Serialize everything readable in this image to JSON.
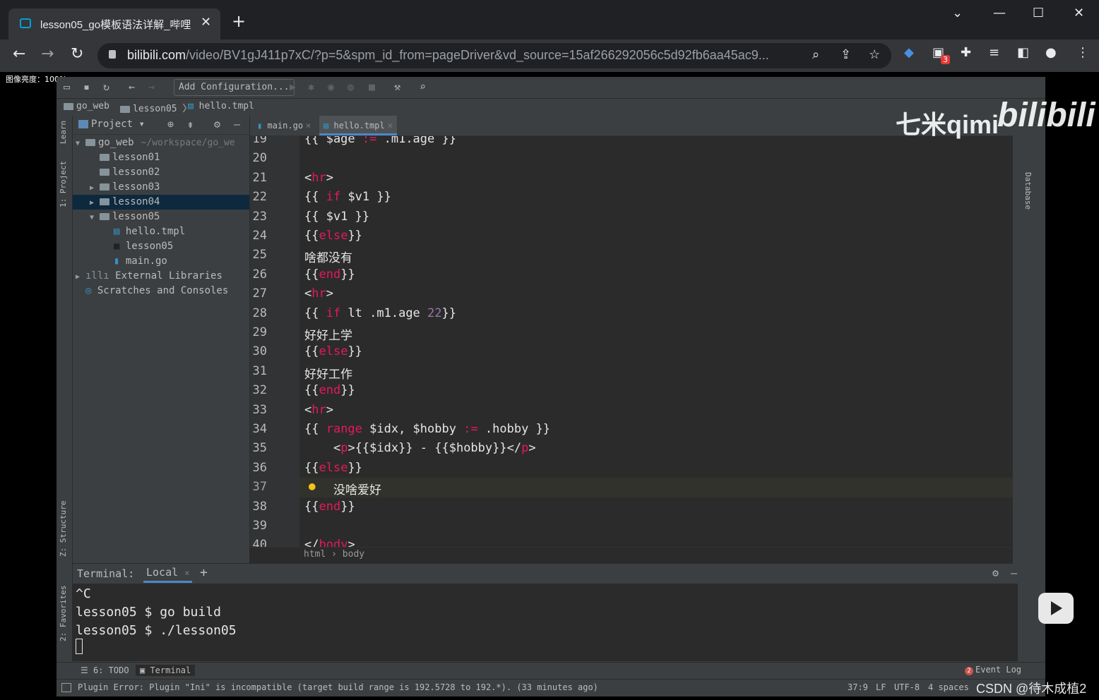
{
  "browser": {
    "tab_title": "lesson05_go模板语法详解_哔哩",
    "tab_close": "✕",
    "new_tab": "+",
    "url_host": "bilibili.com",
    "url_path": "/video/BV1gJ411p7xC/?p=5&spm_id_from=pageDriver&vd_source=15af266292056c5d92fb6aa45ac9...",
    "extension_badge": "3",
    "icons": [
      "back-icon",
      "forward-icon",
      "reload-icon",
      "lock-icon",
      "zoom-icon",
      "share-icon",
      "star-icon",
      "extensions-icon",
      "reading-list-icon",
      "sidepanel-icon",
      "profile-icon",
      "menu-icon"
    ]
  },
  "overlay": {
    "brightness": "图像亮度：100%",
    "watermark_qimi": "七米qimi",
    "watermark_bili": "bilibili",
    "csdn": "CSDN @待木成植2"
  },
  "ide": {
    "add_configuration": "Add Configuration...",
    "breadcrumb": [
      "go_web",
      "lesson05",
      "hello.tmpl"
    ],
    "left_strip": [
      "Learn",
      "1: Project",
      "Z: Structure",
      "2: Favorites"
    ],
    "right_strip": "Database",
    "project": {
      "title": "Project",
      "tree": [
        {
          "label": "go_web",
          "path": "~/workspace/go_we",
          "arrow": "▼",
          "indent": 0
        },
        {
          "label": "lesson01",
          "arrow": "",
          "indent": 1
        },
        {
          "label": "lesson02",
          "arrow": "",
          "indent": 1
        },
        {
          "label": "lesson03",
          "arrow": "▶",
          "indent": 1
        },
        {
          "label": "lesson04",
          "arrow": "▶",
          "indent": 1,
          "selected": true
        },
        {
          "label": "lesson05",
          "arrow": "▼",
          "indent": 1
        },
        {
          "label": "hello.tmpl",
          "arrow": "",
          "indent": 2
        },
        {
          "label": "lesson05",
          "arrow": "",
          "indent": 2
        },
        {
          "label": "main.go",
          "arrow": "",
          "indent": 2
        },
        {
          "label": "External Libraries",
          "arrow": "▶",
          "indent": 0
        },
        {
          "label": "Scratches and Consoles",
          "arrow": "",
          "indent": 0
        }
      ]
    },
    "tabs": [
      {
        "label": "main.go",
        "active": false
      },
      {
        "label": "hello.tmpl",
        "active": true
      }
    ],
    "editor": {
      "lines": [
        {
          "n": "19",
          "html": "{{ $age <span class=\"o\">:=</span> .m1.age }}"
        },
        {
          "n": "20",
          "html": ""
        },
        {
          "n": "21",
          "html": "&lt;<span class=\"tg\">hr</span>&gt;"
        },
        {
          "n": "22",
          "html": "{{ <span class=\"k\">if</span> $v1 }}"
        },
        {
          "n": "23",
          "html": "{{ $v1 }}"
        },
        {
          "n": "24",
          "html": "{{<span class=\"k\">else</span>}}"
        },
        {
          "n": "25",
          "html": "啥都没有"
        },
        {
          "n": "26",
          "html": "{{<span class=\"k\">end</span>}}"
        },
        {
          "n": "27",
          "html": "&lt;<span class=\"tg\">hr</span>&gt;"
        },
        {
          "n": "28",
          "html": "{{ <span class=\"k\">if</span> lt .m1.age <span class=\"n\">22</span>}}"
        },
        {
          "n": "29",
          "html": "好好上学"
        },
        {
          "n": "30",
          "html": "{{<span class=\"k\">else</span>}}"
        },
        {
          "n": "31",
          "html": "好好工作"
        },
        {
          "n": "32",
          "html": "{{<span class=\"k\">end</span>}}"
        },
        {
          "n": "33",
          "html": "&lt;<span class=\"tg\">hr</span>&gt;"
        },
        {
          "n": "34",
          "html": "{{ <span class=\"k\">range</span> $idx, $hobby <span class=\"o\">:=</span> .hobby }}"
        },
        {
          "n": "35",
          "html": "    &lt;<span class=\"tg\">p</span>&gt;{{$idx}} - {{$hobby}}&lt;/<span class=\"tg\">p</span>&gt;"
        },
        {
          "n": "36",
          "html": "{{<span class=\"k\">else</span>}}"
        },
        {
          "n": "37",
          "html": "    没啥爱好"
        },
        {
          "n": "38",
          "html": "{{<span class=\"k\">end</span>}}"
        },
        {
          "n": "39",
          "html": ""
        },
        {
          "n": "40",
          "html": "&lt;/<span class=\"tg\">body</span>&gt;"
        }
      ],
      "bottom_crumbs": "html › body"
    },
    "terminal": {
      "label": "Terminal:",
      "tab": "Local",
      "tab_close": "×",
      "add": "+",
      "lines": [
        "^C",
        "lesson05 $ go build",
        "lesson05 $ ./lesson05"
      ]
    },
    "bottom_tools": {
      "todo": "6: TODO",
      "terminal": "Terminal",
      "event_log": "Event Log",
      "event_count": "2"
    },
    "status": {
      "message": "Plugin Error: Plugin \"Ini\" is incompatible (target build range is 192.5728 to 192.*). (33 minutes ago)",
      "position": "37:9",
      "line_sep": "LF",
      "encoding": "UTF-8",
      "indent": "4 spaces"
    }
  }
}
